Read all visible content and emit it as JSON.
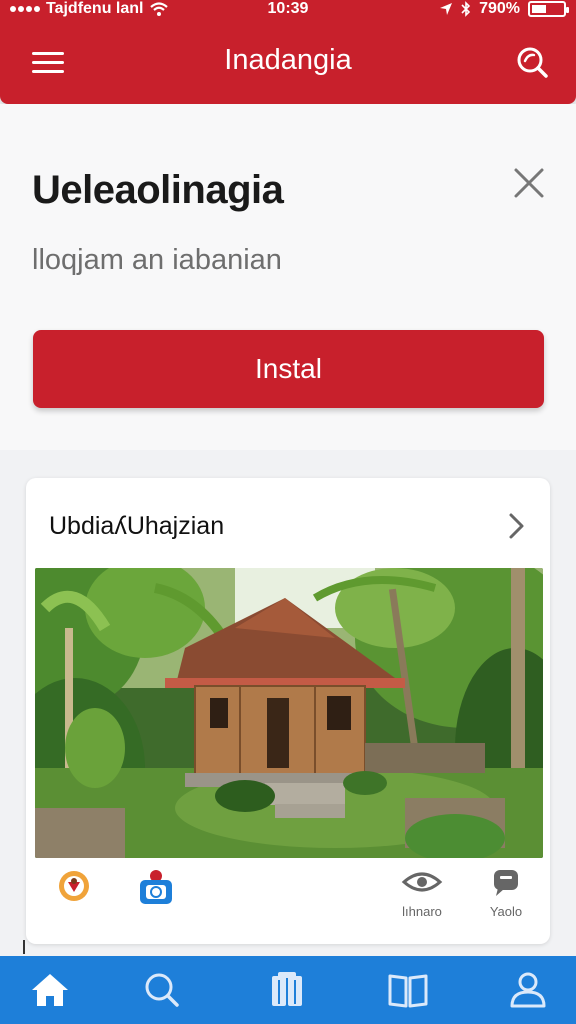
{
  "status_bar": {
    "carrier": "Tajdfenu lanl",
    "time": "10:39",
    "battery": "790%"
  },
  "header": {
    "title": "Inadangia",
    "icons": {
      "menu": "hamburger-menu-icon",
      "search": "search-icon"
    }
  },
  "install_card": {
    "title": "Ueleaolinagia",
    "subtitle": "lloqjam an iabanian",
    "button_label": "Instal",
    "close_icon": "close-icon"
  },
  "content_card": {
    "title": "UbdiaʎUhajzian",
    "chevron_icon": "chevron-right-icon",
    "image_alt": "wooden house in tropical garden",
    "actions": {
      "left_1": {
        "icon": "badge-emblem-icon"
      },
      "left_2": {
        "icon": "robot-camera-icon"
      },
      "right_1": {
        "icon": "eye-icon",
        "label": "lıhnaro"
      },
      "right_2": {
        "icon": "chat-icon",
        "label": "Yaolo"
      }
    }
  },
  "bottom_nav": {
    "items": [
      {
        "id": "home",
        "icon": "home-icon"
      },
      {
        "id": "search",
        "icon": "search-icon"
      },
      {
        "id": "library",
        "icon": "books-icon"
      },
      {
        "id": "reading",
        "icon": "open-book-icon"
      },
      {
        "id": "profile",
        "icon": "user-icon"
      }
    ]
  },
  "colors": {
    "brand_red": "#c8202c",
    "nav_blue": "#1e7fd9",
    "background": "#f1f2f4"
  }
}
